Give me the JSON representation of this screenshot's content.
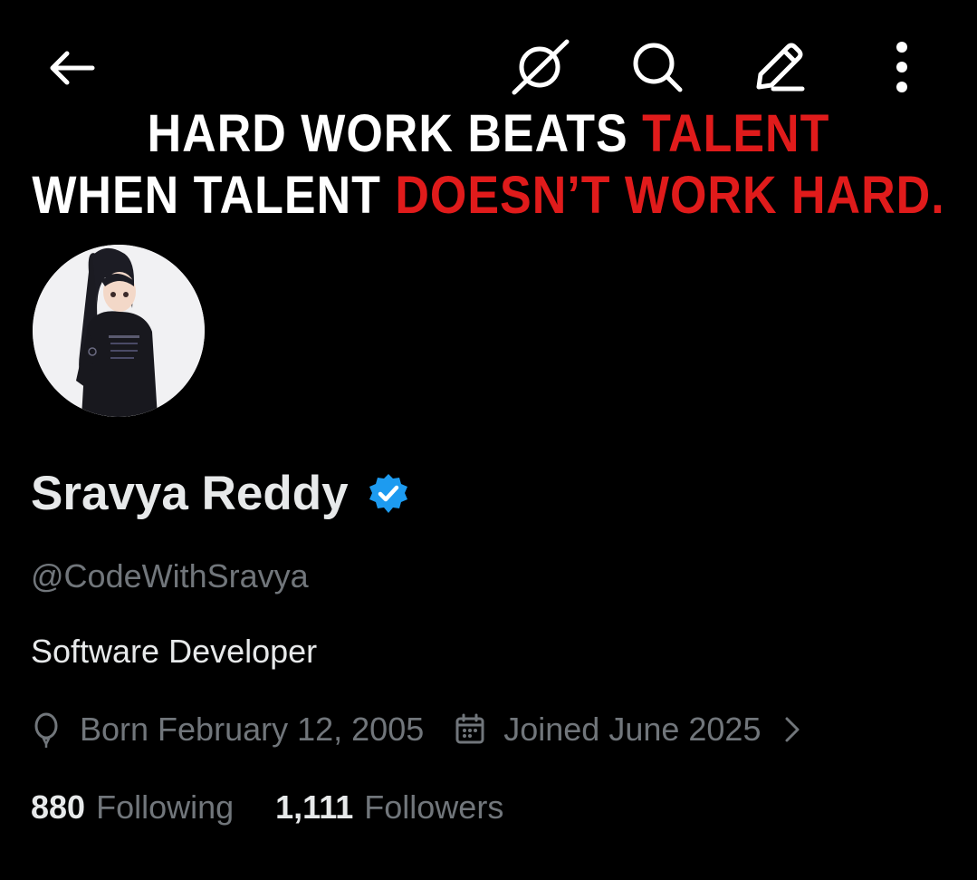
{
  "banner": {
    "line1": {
      "white": "HARD WORK BEATS ",
      "red": "TALENT"
    },
    "line2": {
      "white": "WHEN TALENT ",
      "red": "DOESN’T WORK HARD."
    }
  },
  "topbar": {
    "icons": [
      "back-arrow-icon",
      "grok-icon",
      "search-icon",
      "edit-icon",
      "more-vertical-icon"
    ]
  },
  "profile": {
    "name": "Sravya Reddy",
    "handle": "@CodeWithSravya",
    "bio": "Software Developer",
    "born": "Born February 12, 2005",
    "joined": "Joined June 2025",
    "following_count": "880",
    "following_label": "Following",
    "followers_count": "1,111",
    "followers_label": "Followers"
  },
  "colors": {
    "background": "#000000",
    "text_primary": "#e7e9ea",
    "text_secondary": "#71767b",
    "verified": "#1d9bf0",
    "banner_red": "#e01b1b"
  }
}
